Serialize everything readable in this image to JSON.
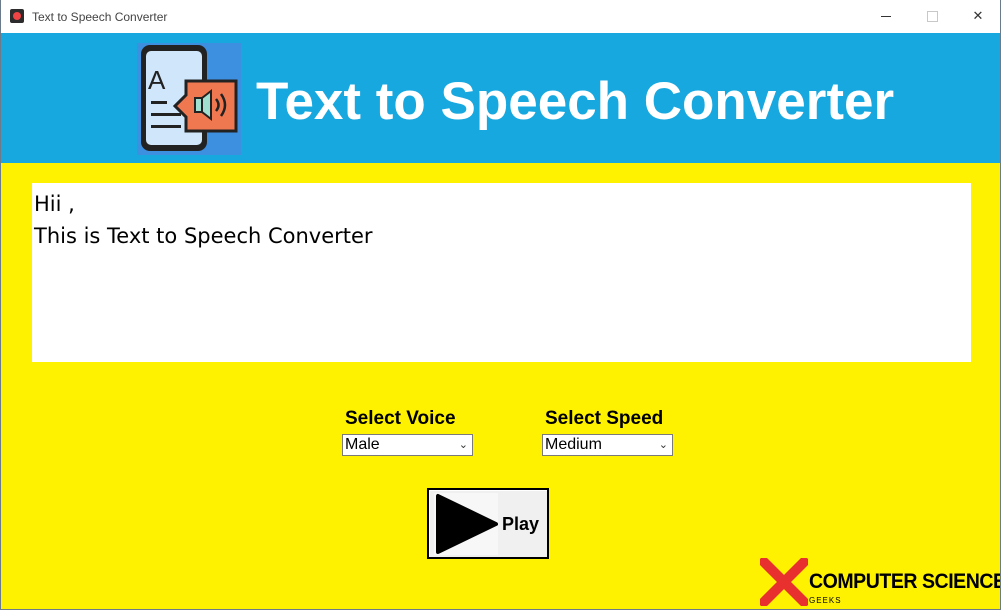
{
  "window": {
    "title": "Text to Speech Converter",
    "controls": {
      "minimize": "minimize-icon",
      "maximize": "maximize-icon",
      "close": "✕"
    }
  },
  "header": {
    "title": "Text to Speech Converter",
    "logo_icon": "phone-speaker-icon",
    "background": "#18a8e0"
  },
  "editor": {
    "text": "Hii ,\nThis is Text to Speech Converter"
  },
  "voice": {
    "label": "Select Voice",
    "selected": "Male"
  },
  "speed": {
    "label": "Select Speed",
    "selected": "Medium"
  },
  "play": {
    "label": "Play",
    "icon": "play-icon"
  },
  "brand": {
    "name": "COMPUTER SCIENCE",
    "sub": "GEEKS",
    "icon": "x-mark-icon"
  },
  "colors": {
    "main_background": "#fff200",
    "header_background": "#18a8e0",
    "brand_red": "#e8312f"
  }
}
